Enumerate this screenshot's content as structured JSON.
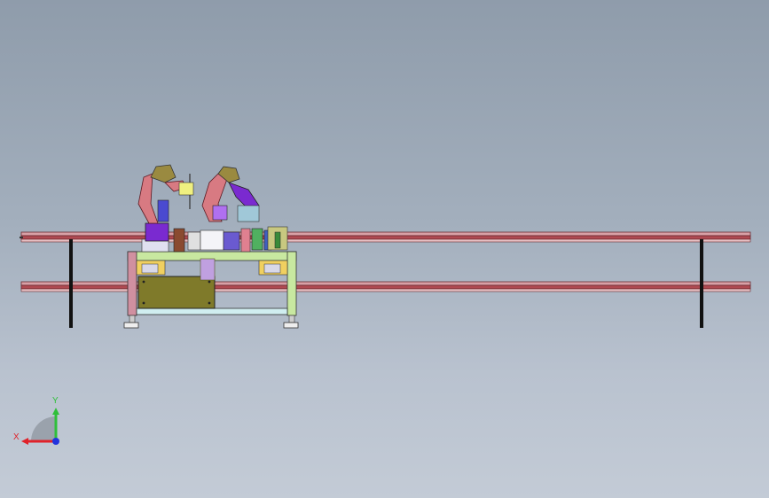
{
  "view": {
    "background_top": "#8f9cab",
    "background_bottom": "#c3cbd6"
  },
  "triad": {
    "x_label": "X",
    "y_label": "Y",
    "x_color": "#e0222a",
    "y_color": "#2fbf3a",
    "z_color": "#2233dd"
  },
  "model": {
    "rail_color": "#b04a52",
    "frame_color": "#c8e8a0",
    "panel_color": "#7f7a2a",
    "robot_color": "#d87a82",
    "accent_purple": "#7a2ad0"
  }
}
